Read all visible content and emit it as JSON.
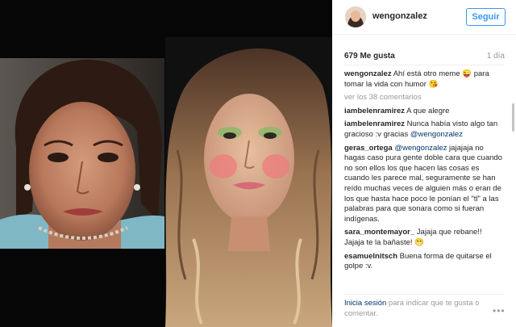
{
  "post": {
    "username": "wengonzalez",
    "follow_label": "Seguir",
    "likes": "679 Me gusta",
    "time_ago": "1 día"
  },
  "comments": {
    "caption_user": "wengonzalez",
    "caption_text": " Ahí está otro meme 😜 para tomar la vida con humor 😘",
    "view_all": "ver los 38 comentarios",
    "items": [
      {
        "user": "iambelenramirez",
        "text": " A que alegre",
        "mention": ""
      },
      {
        "user": "iambelenramirez",
        "text": " Nunca había visto algo tan gracioso :v gracias ",
        "mention": "@wengonzalez"
      },
      {
        "user": "geras_ortega",
        "text": " jajajaja no hagas caso pura gente doble cara que cuando no son ellos los que hacen las cosas es cuando les parece mal, seguramente se han reído muchas veces de alguien más o eran de los que hasta hace poco le ponían el \"tl\" a las palabras para que sonara como si fueran indígenas.",
        "mention": "@wengonzalez"
      },
      {
        "user": "sara_montemayor_",
        "text": " Jajaja que rebane!! Jajaja te la bañaste! 😁",
        "mention": ""
      },
      {
        "user": "esamuelnitsch",
        "text": " Buena forma de quitarse el golpe :v.",
        "mention": ""
      }
    ]
  },
  "footer": {
    "login_link": "Inicia sesión",
    "login_text": " para indicar que te gusta o comentar.",
    "more_icon": "ellipsis-icon"
  }
}
